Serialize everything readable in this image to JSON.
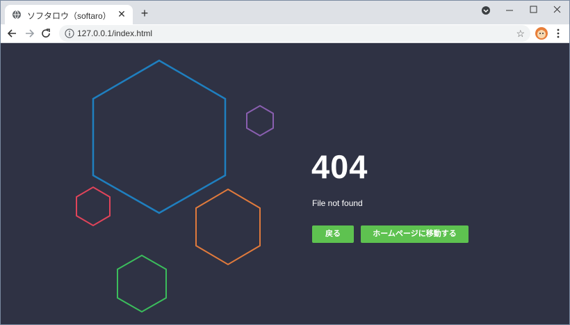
{
  "browser": {
    "tab": {
      "title": "ソフタロウ（softaro）",
      "favicon": "globe-icon",
      "close_label": "✕"
    },
    "new_tab_label": "+",
    "toolbar": {
      "url": "127.0.0.1/index.html",
      "info_icon": "info-icon",
      "bookmark_icon": "star-icon"
    }
  },
  "page": {
    "error_code": "404",
    "message": "File not found",
    "back_button": "戻る",
    "home_button": "ホームページに移動する",
    "button_color": "#5ec250"
  },
  "decorations": {
    "hexagon_colors": [
      "#1f7fbf",
      "#8a5fb0",
      "#e0445a",
      "#e07a3c",
      "#3bbd5c"
    ]
  }
}
